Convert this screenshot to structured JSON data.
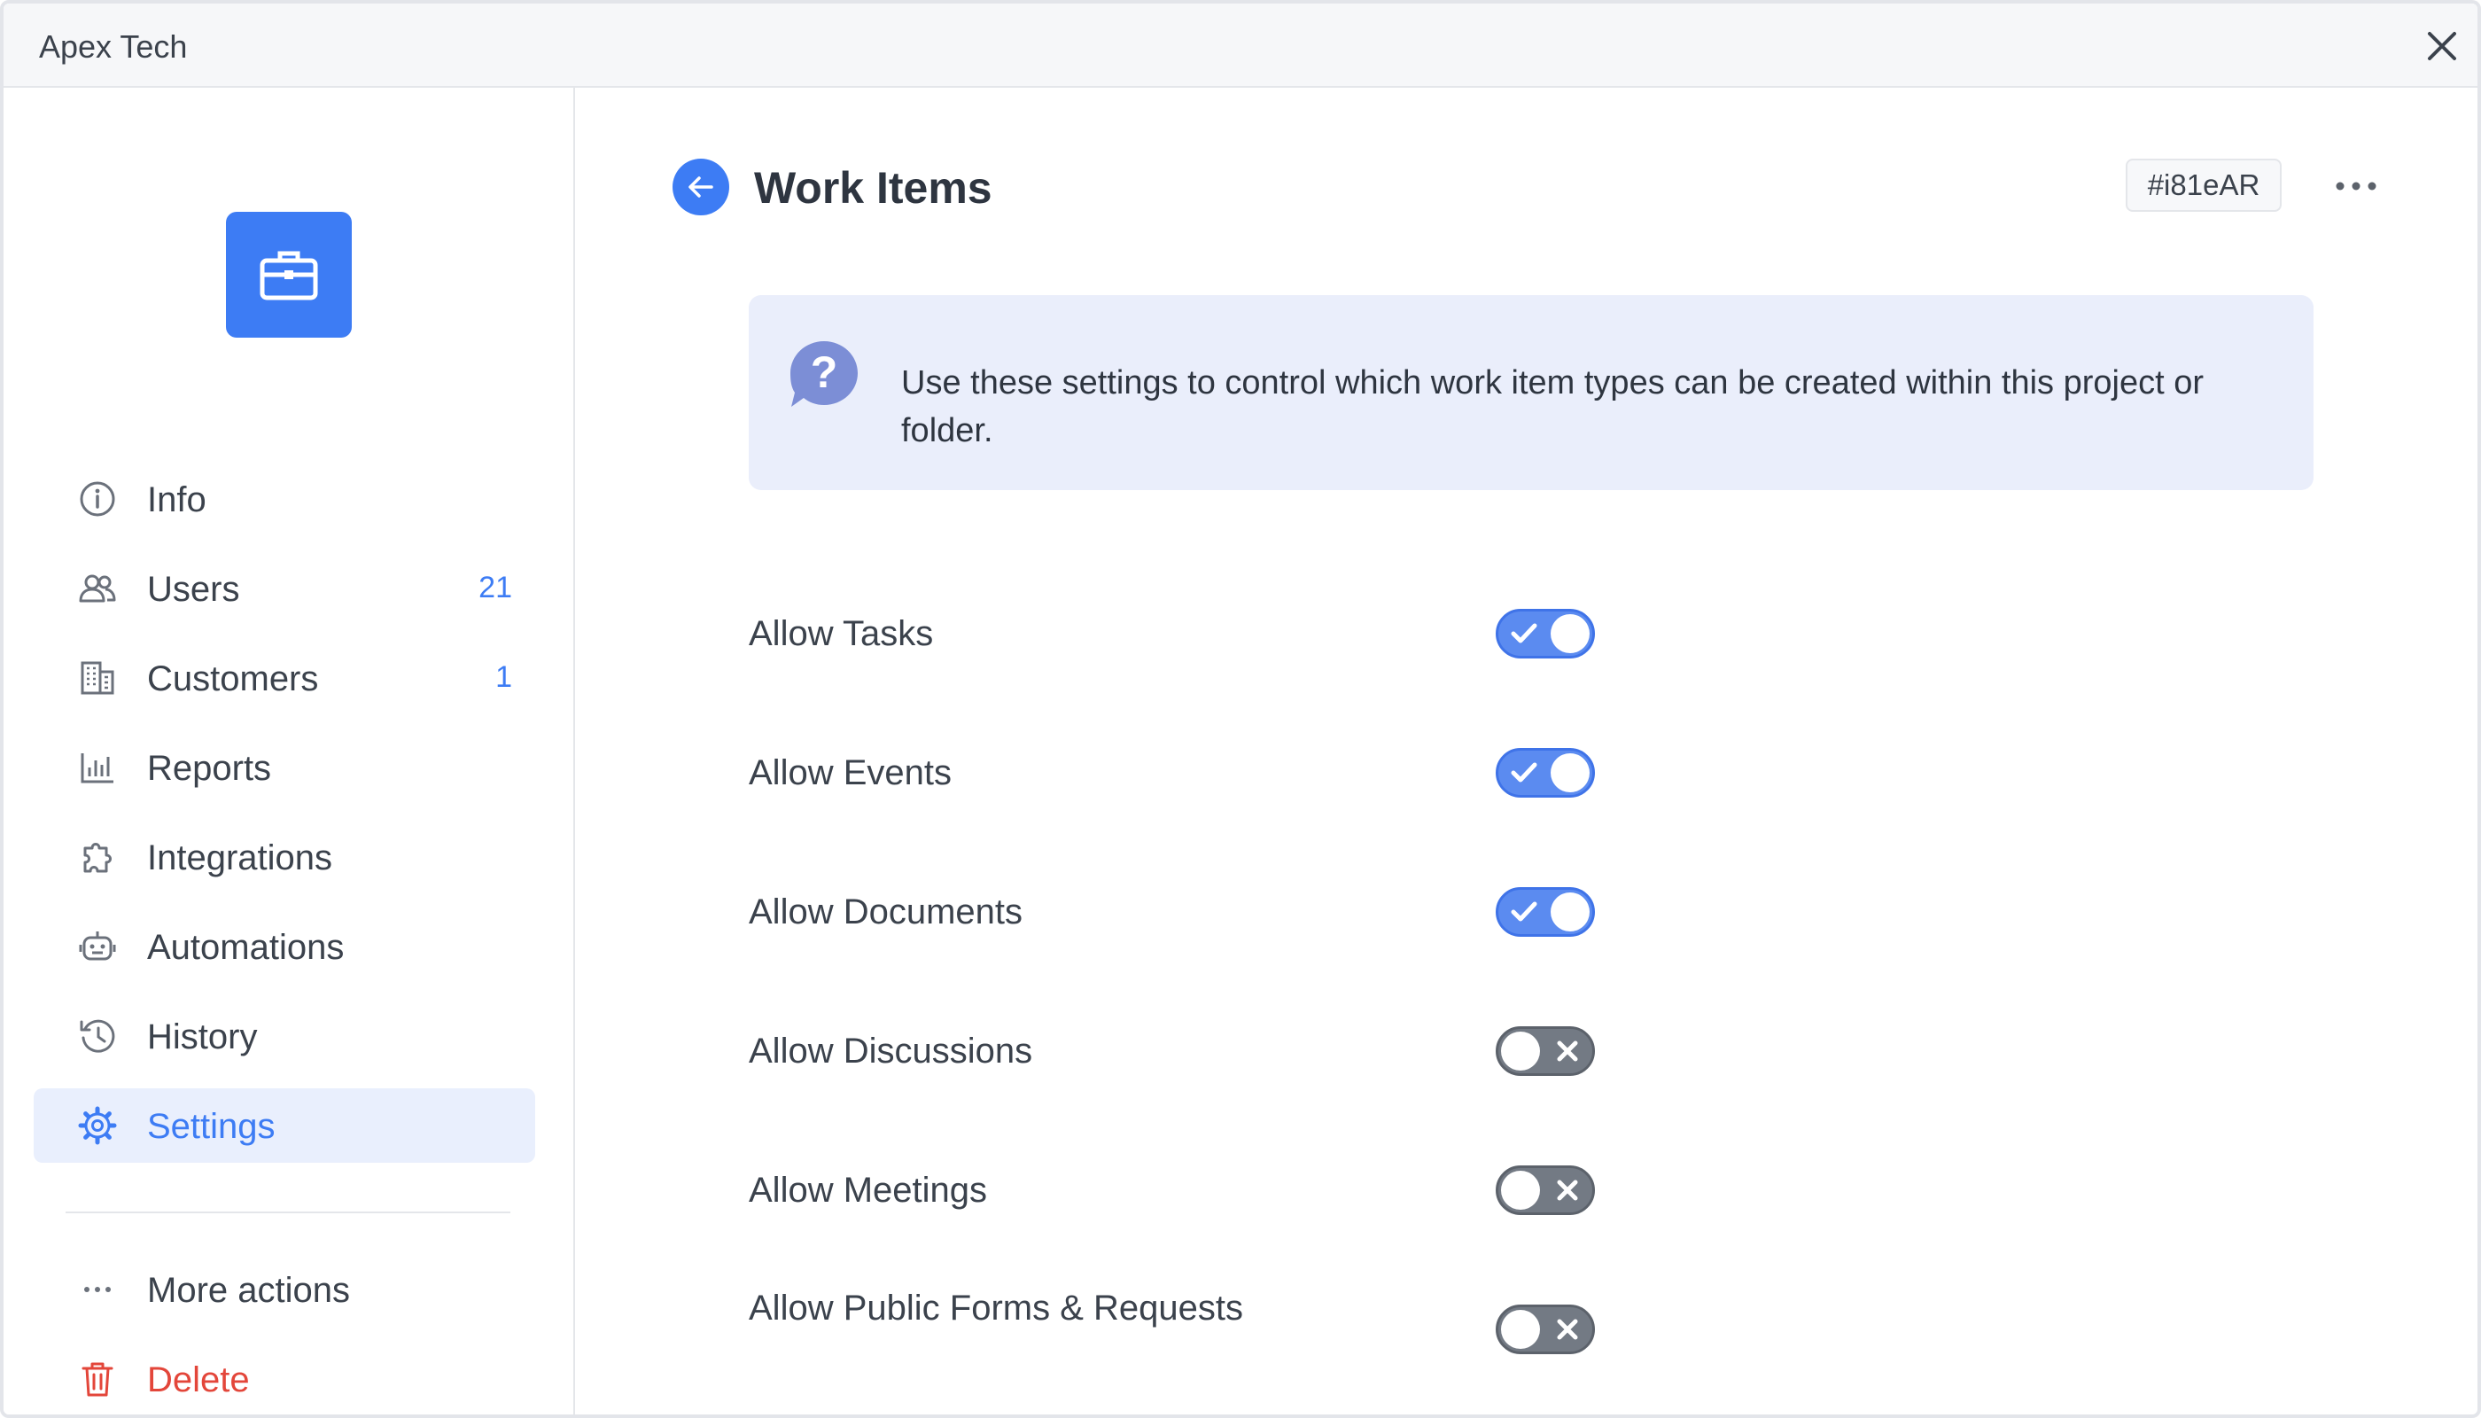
{
  "window": {
    "title": "Apex Tech"
  },
  "sidebar": {
    "items": [
      {
        "key": "info",
        "label": "Info",
        "count": "",
        "icon": "info-icon"
      },
      {
        "key": "users",
        "label": "Users",
        "count": "21",
        "icon": "users-icon"
      },
      {
        "key": "customers",
        "label": "Customers",
        "count": "1",
        "icon": "building-icon"
      },
      {
        "key": "reports",
        "label": "Reports",
        "count": "",
        "icon": "bar-chart-icon"
      },
      {
        "key": "integrations",
        "label": "Integrations",
        "count": "",
        "icon": "puzzle-icon"
      },
      {
        "key": "automations",
        "label": "Automations",
        "count": "",
        "icon": "robot-icon"
      },
      {
        "key": "history",
        "label": "History",
        "count": "",
        "icon": "history-icon"
      },
      {
        "key": "settings",
        "label": "Settings",
        "count": "",
        "icon": "gear-icon",
        "active": true
      }
    ],
    "more_actions": "More actions",
    "delete": "Delete",
    "logo_icon": "briefcase-icon"
  },
  "main": {
    "title": "Work Items",
    "id_badge": "#i81eAR",
    "info_text": "Use these settings to control which work item types can be created within this project or folder.",
    "settings": [
      {
        "label": "Allow Tasks",
        "enabled": true
      },
      {
        "label": "Allow Events",
        "enabled": true
      },
      {
        "label": "Allow Documents",
        "enabled": true
      },
      {
        "label": "Allow Discussions",
        "enabled": false
      },
      {
        "label": "Allow Meetings",
        "enabled": false
      },
      {
        "label": "Allow Public Forms & Requests",
        "enabled": false
      }
    ]
  },
  "colors": {
    "accent": "#3d7cf4",
    "toggle_on": "#5b8bf0",
    "toggle_off": "#737a84",
    "danger": "#e3463a",
    "info_bg": "#eaeefb"
  }
}
